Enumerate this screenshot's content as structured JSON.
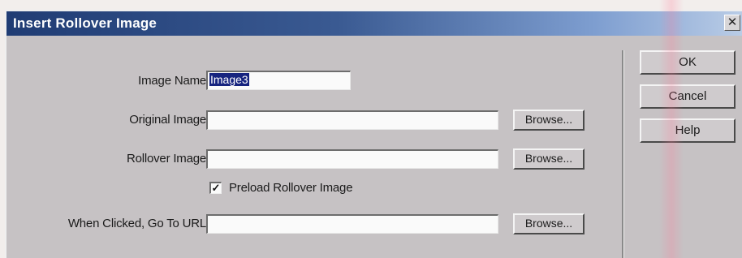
{
  "window": {
    "title": "Insert Rollover Image",
    "close_glyph": "✕"
  },
  "form": {
    "image_name": {
      "label": "Image Name:",
      "value": "Image3"
    },
    "original_image": {
      "label": "Original Image:",
      "value": "",
      "browse_label": "Browse..."
    },
    "rollover_image": {
      "label": "Rollover Image:",
      "value": "",
      "browse_label": "Browse..."
    },
    "preload": {
      "label": "Preload Rollover Image",
      "checked": true
    },
    "url": {
      "label": "When Clicked, Go To URL:",
      "value": "",
      "browse_label": "Browse..."
    }
  },
  "buttons": {
    "ok": "OK",
    "cancel": "Cancel",
    "help": "Help"
  }
}
